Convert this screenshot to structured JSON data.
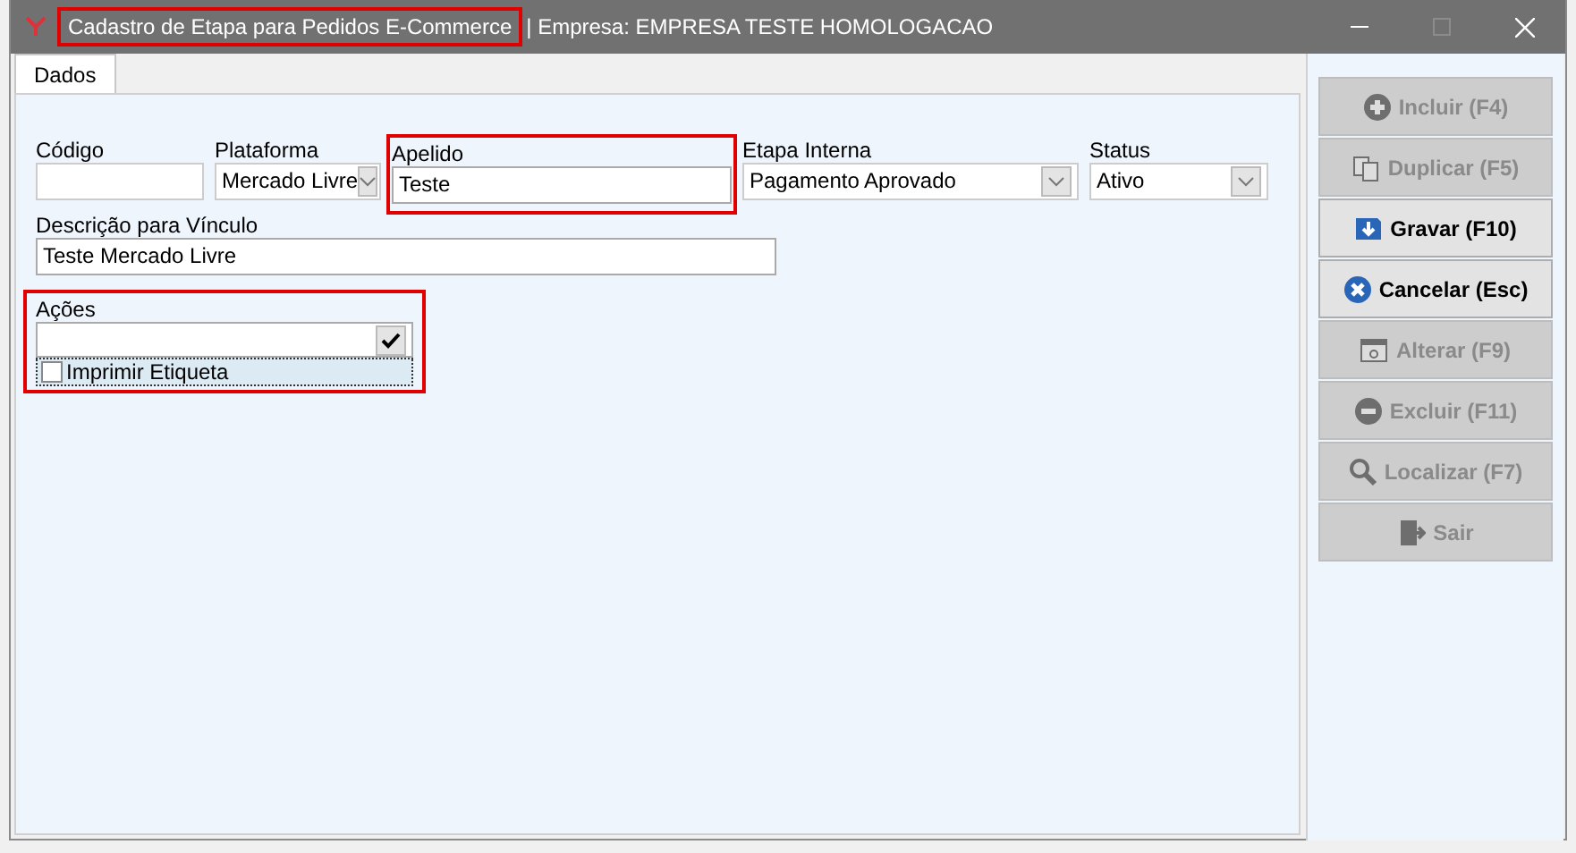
{
  "window": {
    "title": "Cadastro de Etapa para Pedidos E-Commerce",
    "title_highlighted": true,
    "subtitle": "| Empresa: EMPRESA TESTE HOMOLOGACAO",
    "maximize_disabled": true
  },
  "tabs": [
    {
      "label": "Dados",
      "selected": true
    }
  ],
  "fields": [
    {
      "kind": "text",
      "label": "Código",
      "highlighted": false
    },
    {
      "kind": "select",
      "label": "Plataforma",
      "value": "Mercado Livre",
      "highlighted": false
    },
    {
      "kind": "text",
      "label": "Apelido",
      "value": "Teste",
      "highlighted": true
    },
    {
      "kind": "select",
      "label": "Etapa Interna",
      "value": "Pagamento Aprovado",
      "highlighted": false
    },
    {
      "kind": "select",
      "label": "Status",
      "value": "Ativo",
      "highlighted": false
    }
  ],
  "description": {
    "label": "Descrição para Vínculo",
    "value": "Teste Mercado Livre"
  },
  "actions": {
    "label": "Ações",
    "highlighted": true,
    "options": [
      {
        "label": "Imprimir Etiqueta",
        "checked": false,
        "focused": true
      }
    ]
  },
  "buttons": [
    {
      "kind": "add",
      "label": "Incluir (F4)",
      "disabled": true
    },
    {
      "kind": "copy",
      "label": "Duplicar (F5)",
      "disabled": true
    },
    {
      "kind": "save",
      "label": "Gravar (F10)",
      "disabled": false
    },
    {
      "kind": "cancel",
      "label": "Cancelar (Esc)",
      "disabled": false
    },
    {
      "kind": "edit",
      "label": "Alterar (F9)",
      "disabled": true
    },
    {
      "kind": "delete",
      "label": "Excluir (F11)",
      "disabled": true
    },
    {
      "kind": "find",
      "label": "Localizar (F7)",
      "disabled": true
    },
    {
      "kind": "exit",
      "label": "Sair",
      "disabled": true
    }
  ]
}
